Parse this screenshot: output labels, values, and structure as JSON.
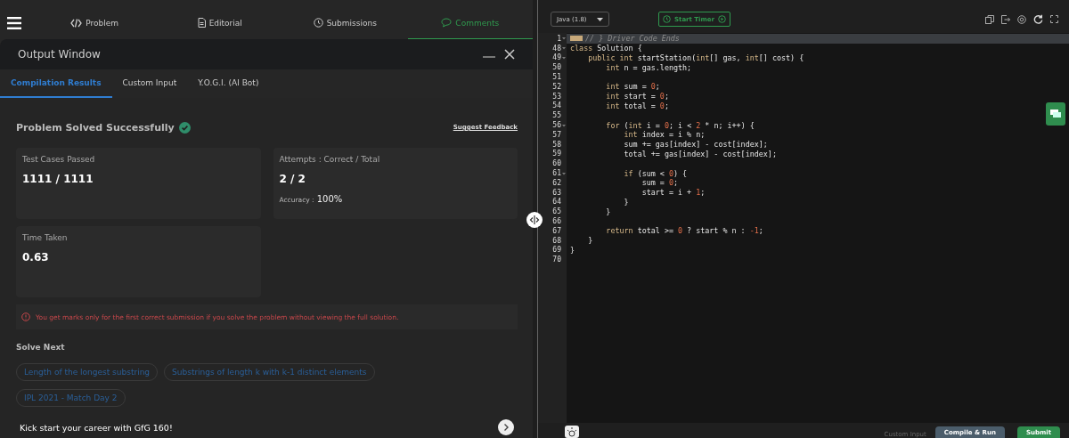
{
  "top_tabs": [
    {
      "label": "Problem",
      "selected": false
    },
    {
      "label": "Editorial",
      "selected": false
    },
    {
      "label": "Submissions",
      "selected": false
    },
    {
      "label": "Comments",
      "selected": true
    }
  ],
  "output_window": {
    "title": "Output Window",
    "tabs": [
      {
        "label": "Compilation Results",
        "selected": true
      },
      {
        "label": "Custom Input",
        "selected": false
      },
      {
        "label": "Y.O.G.I. (AI Bot)",
        "selected": false
      }
    ],
    "status": "Problem Solved Successfully",
    "feedback_link": "Suggest Feedback",
    "stats": [
      {
        "label": "Test Cases Passed",
        "value": "1111 / 1111"
      },
      {
        "label": "Attempts : Correct / Total",
        "value": "2 / 2",
        "sub_label": "Accuracy :",
        "sub_value": "100%"
      },
      {
        "label": "Time Taken",
        "value": "0.63"
      }
    ],
    "notice": "You get marks only for the first correct submission if you solve the problem without viewing the full solution.",
    "solve_next_title": "Solve Next",
    "solve_next": [
      "Length of the longest substring",
      "Substrings of length k with k-1 distinct elements",
      "IPL 2021 - Match Day 2"
    ],
    "promo": "Kick start your career with GfG 160!"
  },
  "editor": {
    "language": "Java (1.8)",
    "timer_button": "Start Timer",
    "lines": [
      {
        "num": "1",
        "fold": true,
        "collapsed": true,
        "tokens": [
          {
            "text": "// } Driver Code Ends",
            "kind": "comment"
          }
        ]
      },
      {
        "num": "48",
        "fold": true,
        "collapsed": false,
        "tokens": [
          {
            "text": "class",
            "kind": "kw"
          },
          {
            "text": " Solution {",
            "kind": "plain"
          }
        ]
      },
      {
        "num": "49",
        "fold": true,
        "collapsed": false,
        "tokens": [
          {
            "text": "    public int",
            "kind": "kw"
          },
          {
            "text": " startStation(",
            "kind": "plain"
          },
          {
            "text": "int",
            "kind": "kw"
          },
          {
            "text": "[] gas, ",
            "kind": "plain"
          },
          {
            "text": "int",
            "kind": "kw"
          },
          {
            "text": "[] cost) {",
            "kind": "plain"
          }
        ]
      },
      {
        "num": "50",
        "fold": false,
        "collapsed": false,
        "tokens": [
          {
            "text": "        int",
            "kind": "kw"
          },
          {
            "text": " n = gas.length;",
            "kind": "plain"
          }
        ]
      },
      {
        "num": "51",
        "fold": false,
        "collapsed": false
      },
      {
        "num": "52",
        "fold": false,
        "collapsed": false,
        "tokens": [
          {
            "text": "        int",
            "kind": "kw"
          },
          {
            "text": " sum = ",
            "kind": "plain"
          },
          {
            "text": "0",
            "kind": "num"
          },
          {
            "text": ";",
            "kind": "plain"
          }
        ]
      },
      {
        "num": "53",
        "fold": false,
        "collapsed": false,
        "tokens": [
          {
            "text": "        int",
            "kind": "kw"
          },
          {
            "text": " start = ",
            "kind": "plain"
          },
          {
            "text": "0",
            "kind": "num"
          },
          {
            "text": ";",
            "kind": "plain"
          }
        ]
      },
      {
        "num": "54",
        "fold": false,
        "collapsed": false,
        "tokens": [
          {
            "text": "        int",
            "kind": "kw"
          },
          {
            "text": " total = ",
            "kind": "plain"
          },
          {
            "text": "0",
            "kind": "num"
          },
          {
            "text": ";",
            "kind": "plain"
          }
        ]
      },
      {
        "num": "55",
        "fold": false,
        "collapsed": false
      },
      {
        "num": "56",
        "fold": true,
        "collapsed": false,
        "tokens": [
          {
            "text": "        for",
            "kind": "kw"
          },
          {
            "text": " (",
            "kind": "plain"
          },
          {
            "text": "int",
            "kind": "kw"
          },
          {
            "text": " i = ",
            "kind": "plain"
          },
          {
            "text": "0",
            "kind": "num"
          },
          {
            "text": "; i < ",
            "kind": "plain"
          },
          {
            "text": "2",
            "kind": "num"
          },
          {
            "text": " * n; i++) {",
            "kind": "plain"
          }
        ]
      },
      {
        "num": "57",
        "fold": false,
        "collapsed": false,
        "tokens": [
          {
            "text": "            int",
            "kind": "kw"
          },
          {
            "text": " index = i % n;",
            "kind": "plain"
          }
        ]
      },
      {
        "num": "58",
        "fold": false,
        "collapsed": false,
        "tokens": [
          {
            "text": "            sum += gas[index] - cost[index];",
            "kind": "plain"
          }
        ]
      },
      {
        "num": "59",
        "fold": false,
        "collapsed": false,
        "tokens": [
          {
            "text": "            total += gas[index] - cost[index];",
            "kind": "plain"
          }
        ]
      },
      {
        "num": "60",
        "fold": false,
        "collapsed": false
      },
      {
        "num": "61",
        "fold": true,
        "collapsed": false,
        "tokens": [
          {
            "text": "            if",
            "kind": "kw"
          },
          {
            "text": " (sum < ",
            "kind": "plain"
          },
          {
            "text": "0",
            "kind": "num"
          },
          {
            "text": ") {",
            "kind": "plain"
          }
        ]
      },
      {
        "num": "62",
        "fold": false,
        "collapsed": false,
        "tokens": [
          {
            "text": "                sum = ",
            "kind": "plain"
          },
          {
            "text": "0",
            "kind": "num"
          },
          {
            "text": ";",
            "kind": "plain"
          }
        ]
      },
      {
        "num": "63",
        "fold": false,
        "collapsed": false,
        "tokens": [
          {
            "text": "                start = i + ",
            "kind": "plain"
          },
          {
            "text": "1",
            "kind": "num"
          },
          {
            "text": ";",
            "kind": "plain"
          }
        ]
      },
      {
        "num": "64",
        "fold": false,
        "collapsed": false,
        "tokens": [
          {
            "text": "            }",
            "kind": "plain"
          }
        ]
      },
      {
        "num": "65",
        "fold": false,
        "collapsed": false,
        "tokens": [
          {
            "text": "        }",
            "kind": "plain"
          }
        ]
      },
      {
        "num": "66",
        "fold": false,
        "collapsed": false
      },
      {
        "num": "67",
        "fold": false,
        "collapsed": false,
        "tokens": [
          {
            "text": "        return",
            "kind": "kw"
          },
          {
            "text": " total >= ",
            "kind": "plain"
          },
          {
            "text": "0",
            "kind": "num"
          },
          {
            "text": " ? start % n : ",
            "kind": "plain"
          },
          {
            "text": "-1",
            "kind": "num"
          },
          {
            "text": ";",
            "kind": "plain"
          }
        ]
      },
      {
        "num": "68",
        "fold": false,
        "collapsed": false,
        "tokens": [
          {
            "text": "    }",
            "kind": "plain"
          }
        ]
      },
      {
        "num": "69",
        "fold": false,
        "collapsed": false,
        "tokens": [
          {
            "text": "}",
            "kind": "plain"
          }
        ]
      },
      {
        "num": "70",
        "fold": false,
        "collapsed": false
      }
    ],
    "custom_input": "Custom Input",
    "compile_button": "Compile & Run",
    "submit_button": "Submit"
  }
}
